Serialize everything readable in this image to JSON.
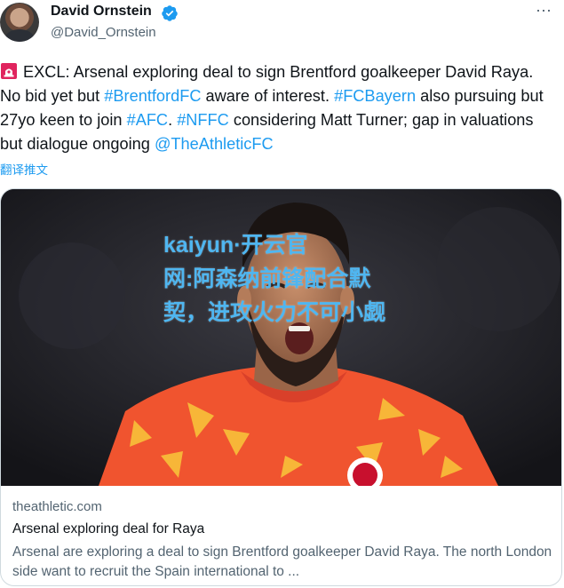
{
  "author": {
    "name": "David Ornstein",
    "handle": "@David_Ornstein",
    "verified_icon": "verified-badge-icon",
    "more_label": "⋯"
  },
  "tweet": {
    "icon": "rotating-light-icon",
    "segments": [
      {
        "text": "EXCL: Arsenal exploring deal to sign Brentford goalkeeper David Raya. No bid yet but ",
        "link": false
      },
      {
        "text": "#BrentfordFC",
        "link": true
      },
      {
        "text": " aware of interest. ",
        "link": false
      },
      {
        "text": "#FCBayern",
        "link": true
      },
      {
        "text": " also pursuing but 27yo keen to join ",
        "link": false
      },
      {
        "text": "#AFC",
        "link": true
      },
      {
        "text": ". ",
        "link": false
      },
      {
        "text": "#NFFC",
        "link": true
      },
      {
        "text": " considering Matt Turner; gap in valuations but dialogue ongoing ",
        "link": false
      },
      {
        "text": "@TheAthleticFC",
        "link": true
      }
    ],
    "translate_label": "翻译推文"
  },
  "card": {
    "overlay_lines": [
      "kaiyun·开云官",
      "网:阿森纳前锋配合默",
      "契，进攻火力不可小觑"
    ],
    "domain": "theathletic.com",
    "title": "Arsenal exploring deal for Raya",
    "description": "Arsenal are exploring a deal to sign Brentford goalkeeper David Raya. The north London side want to recruit the Spain international to ..."
  },
  "colors": {
    "link": "#1d9bf0",
    "secondary_text": "#536471",
    "overlay_text": "#4fb6f0",
    "jersey": "#f0542f"
  }
}
